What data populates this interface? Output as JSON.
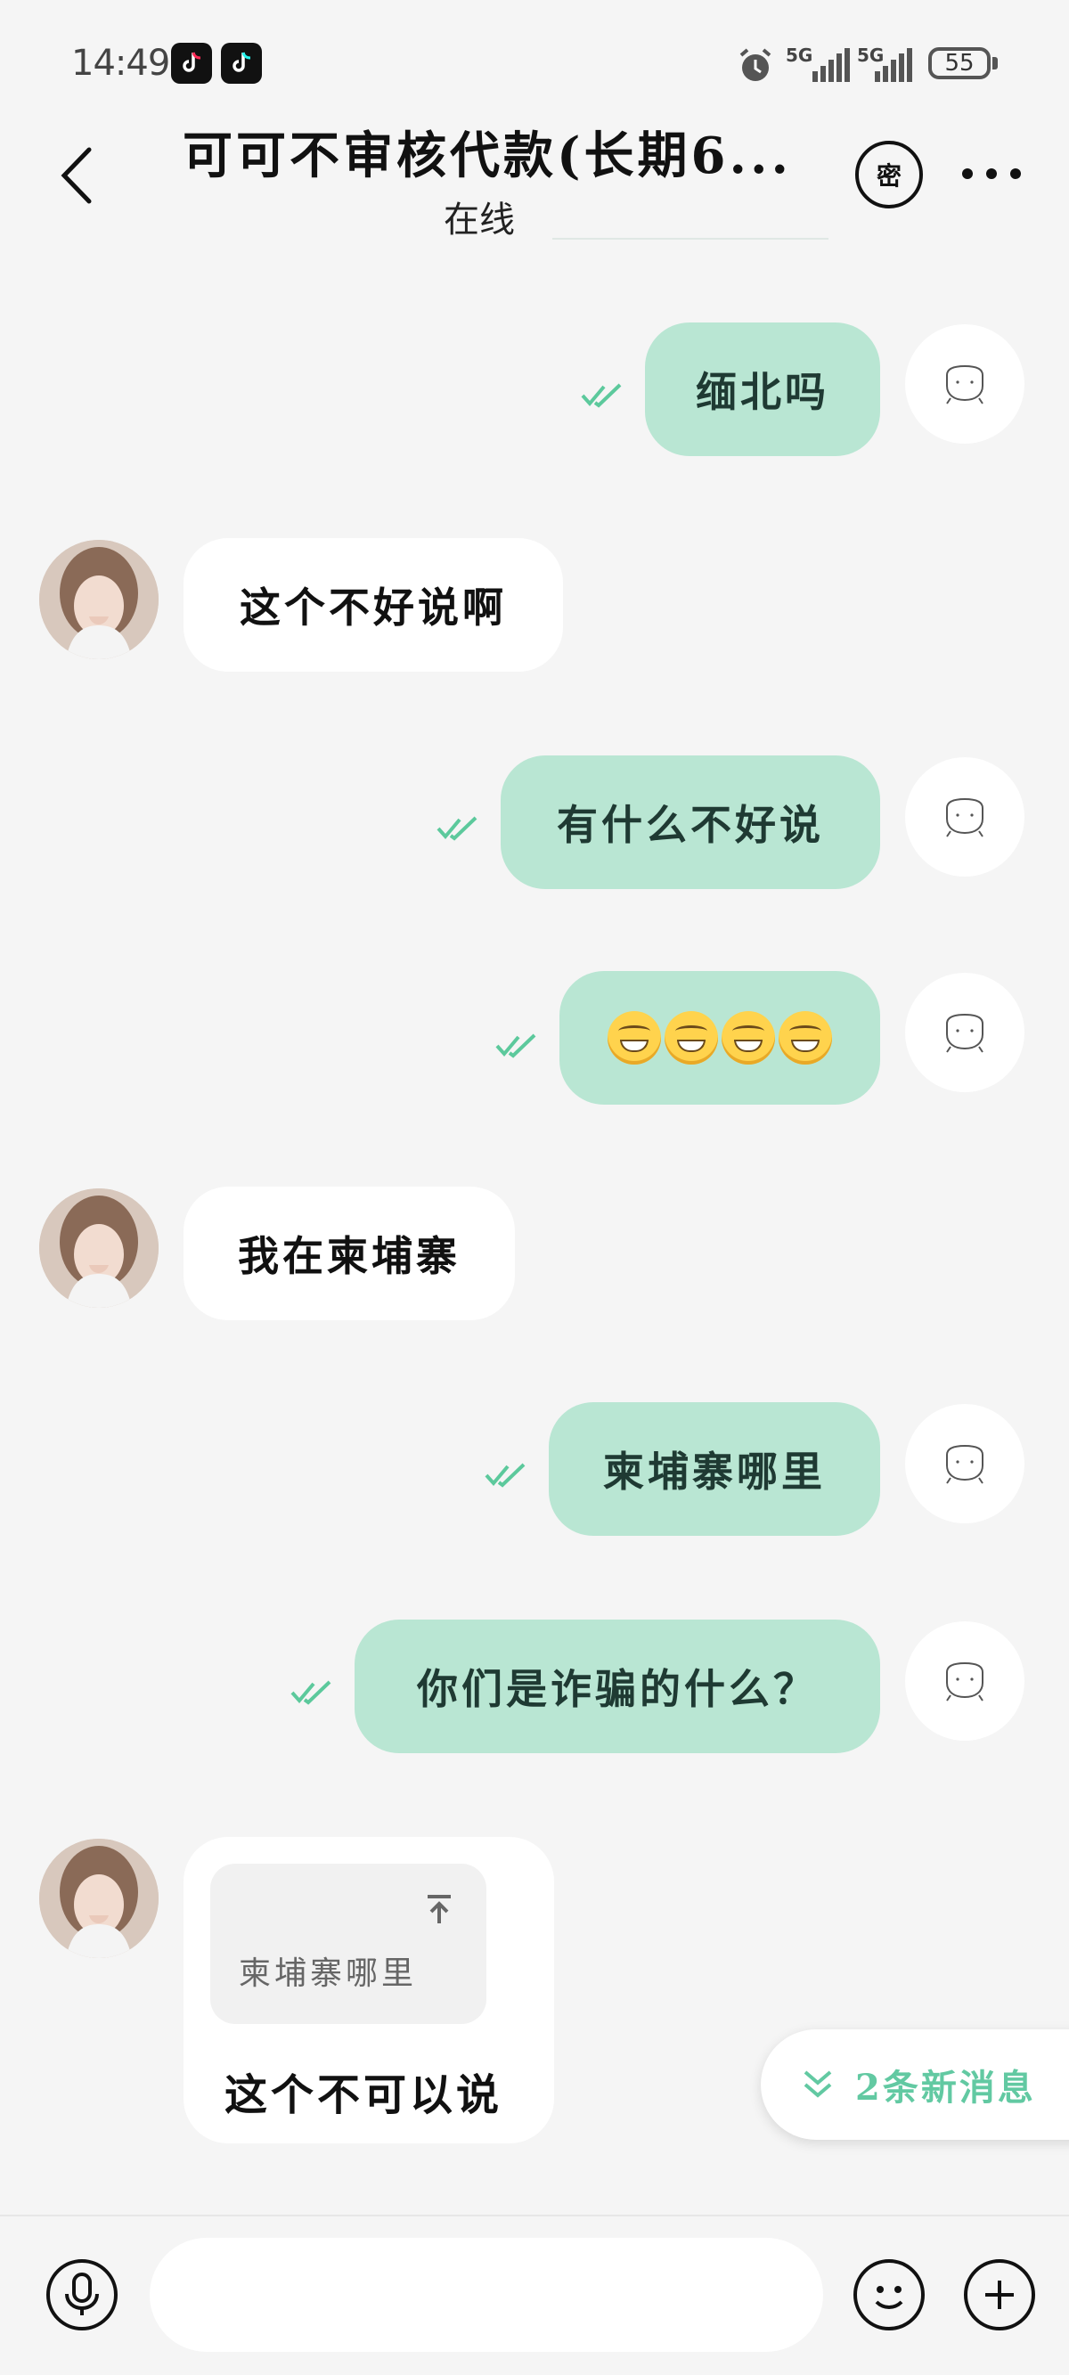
{
  "status_bar": {
    "time": "14:49",
    "apps": [
      "douyin-lite-icon",
      "douyin-icon"
    ],
    "network_1": "5G",
    "network_2": "5G",
    "battery": "55"
  },
  "header": {
    "title": "可可不审核代款(长期6...",
    "subtitle": "在线",
    "secret_label": "密"
  },
  "messages": [
    {
      "side": "out",
      "text": "缅北吗",
      "read": true
    },
    {
      "side": "in",
      "text": "这个不好说啊"
    },
    {
      "side": "out",
      "text": "有什么不好说",
      "read": true
    },
    {
      "side": "out",
      "text": "😁😁😁😁",
      "emoji_count": 4,
      "read": true
    },
    {
      "side": "in",
      "text": "我在柬埔寨"
    },
    {
      "side": "out",
      "text": "柬埔寨哪里",
      "read": true
    },
    {
      "side": "out",
      "text": "你们是诈骗的什么？",
      "read": true
    },
    {
      "side": "in",
      "text": "这个不可以说",
      "quote": "柬埔寨哪里"
    }
  ],
  "new_messages": {
    "label": "2条新消息"
  },
  "colors": {
    "outgoing_bubble": "#b9e6d3",
    "accent": "#62c9a2",
    "background": "#f5f5f5"
  }
}
